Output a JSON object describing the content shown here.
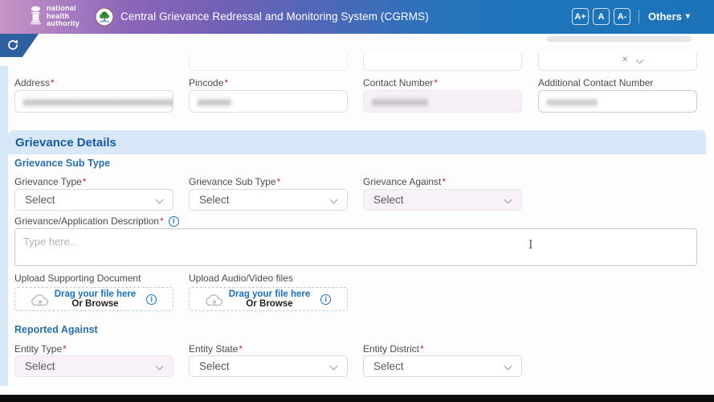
{
  "required_marker": "*",
  "icons": {
    "refresh": "circular-arrow",
    "chevron_down": "⌄",
    "clear": "✕",
    "info": "i",
    "upload_cloud": "cloud-with-up-arrow",
    "others_caret": "▾",
    "text_cursor": "I"
  },
  "header": {
    "brand_lines": [
      "national",
      "health",
      "authority"
    ],
    "app_title": "Central Grievance Redressal and Monitoring System (CGRMS)",
    "font_buttons": [
      "A+",
      "A",
      "A-"
    ],
    "others_label": "Others"
  },
  "row1": {
    "fields": [
      {
        "label": "Address",
        "required": true,
        "masked_value": "xxxxxxxxxxxxxxxxxxxxxxxxxxxxxx"
      },
      {
        "label": "Pincode",
        "required": true,
        "masked_value": "xxxxxx"
      },
      {
        "label": "Contact Number",
        "required": true,
        "masked_value": "xxxxxxxxxx"
      },
      {
        "label": "Additional Contact Number",
        "required": false,
        "masked_value": "xxxxxxxxx"
      }
    ]
  },
  "grievance": {
    "section_title": "Grievance Details",
    "subsection_title": "Grievance Sub Type",
    "selects": [
      {
        "label": "Grievance Type",
        "required": true,
        "value": "Select"
      },
      {
        "label": "Grievance Sub Type",
        "required": true,
        "value": "Select"
      },
      {
        "label": "Grievance Against",
        "required": true,
        "value": "Select"
      }
    ],
    "description_label": "Grievance/Application Description",
    "description_placeholder": "Type here..",
    "uploads": [
      {
        "label": "Upload Supporting Document",
        "drag_text": "Drag your file here",
        "browse_text": "Or Browse"
      },
      {
        "label": "Upload Audio/Video files",
        "drag_text": "Drag your file here",
        "browse_text": "Or Browse"
      }
    ]
  },
  "reported": {
    "subsection_title": "Reported Against",
    "selects": [
      {
        "label": "Entity Type",
        "required": true,
        "value": "Select"
      },
      {
        "label": "Entity State",
        "required": true,
        "value": "Select"
      },
      {
        "label": "Entity District",
        "required": true,
        "value": "Select"
      }
    ]
  },
  "colors": {
    "header_pink": "#c894c7",
    "header_purple": "#8b66b9",
    "header_blue": "#1e75ba",
    "refresh_tab_blue": "#2e5f9e",
    "section_bg": "#d9e8f9",
    "section_text": "#17599f",
    "accent_blue": "#1a6fb5",
    "highlight_field_bg": "#f8f1f8"
  }
}
